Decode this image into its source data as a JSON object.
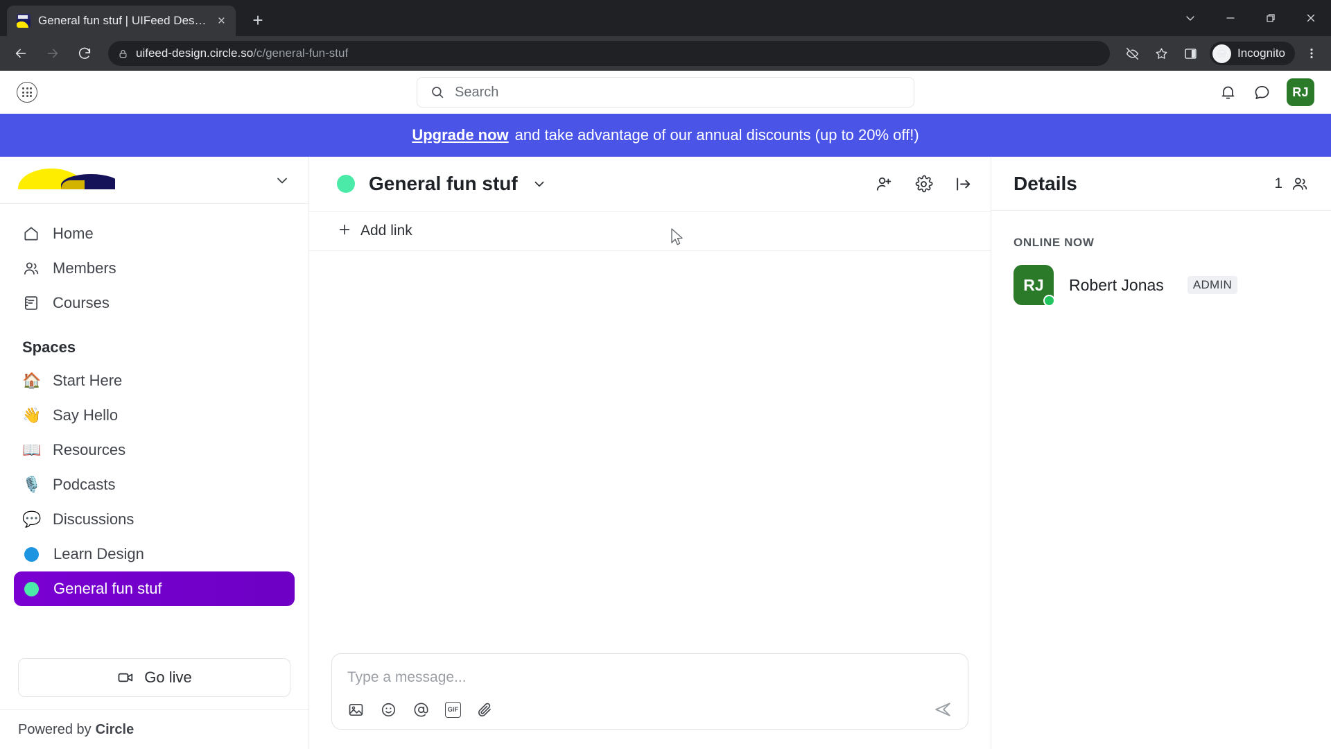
{
  "browser": {
    "tab": {
      "title": "General fun stuf | UIFeed Design",
      "favicon": "uifeed-favicon",
      "close": "×"
    },
    "new_tab_label": "+",
    "window_controls": [
      "chevron-down-icon",
      "minimize-icon",
      "restore-icon",
      "close-icon"
    ],
    "nav": {
      "back": "back-arrow-icon",
      "forward": "forward-arrow-icon",
      "reload": "reload-icon"
    },
    "omnibox": {
      "lock": "lock-icon",
      "domain": "uifeed-design.circle.so",
      "path": "/c/general-fun-stuf"
    },
    "actions": {
      "tracking_protection": "eye-off-icon",
      "bookmark": "star-icon",
      "side_panel": "side-panel-icon",
      "profile_label": "Incognito",
      "menu": "three-dot-menu-icon"
    }
  },
  "app_header": {
    "apps_icon": "apps-grid-icon",
    "search": {
      "placeholder": "Search",
      "value": "",
      "icon": "search-icon"
    },
    "notifications_icon": "bell-icon",
    "messages_icon": "chat-bubble-icon",
    "avatar": {
      "initials": "RJ",
      "color": "#2a7a2a"
    }
  },
  "banner": {
    "link_text": "Upgrade now",
    "text": "and take advantage of our annual discounts (up to 20% off!)",
    "color": "#4a55e8"
  },
  "sidebar": {
    "community_logo": "uifeed-design-logo",
    "community_chevron": "chevron-down-icon",
    "nav": [
      {
        "label": "Home",
        "icon": "home-icon"
      },
      {
        "label": "Members",
        "icon": "members-icon"
      },
      {
        "label": "Courses",
        "icon": "courses-icon"
      }
    ],
    "spaces_heading": "Spaces",
    "spaces": [
      {
        "label": "Start Here",
        "emoji": "🏠",
        "type": "emoji"
      },
      {
        "label": "Say Hello",
        "emoji": "👋",
        "type": "emoji"
      },
      {
        "label": "Resources",
        "emoji": "📖",
        "type": "emoji"
      },
      {
        "label": "Podcasts",
        "emoji": "🎙️",
        "type": "emoji"
      },
      {
        "label": "Discussions",
        "emoji": "💬",
        "type": "emoji"
      },
      {
        "label": "Learn Design",
        "type": "dot",
        "color": "#1e95e0",
        "active": false
      },
      {
        "label": "General fun stuf",
        "type": "dot",
        "color": "#4ceaa8",
        "active": true
      }
    ],
    "go_live": {
      "label": "Go live",
      "icon": "video-camera-icon"
    },
    "powered_by": {
      "prefix": "Powered by",
      "brand": "Circle"
    }
  },
  "channel": {
    "dot_color": "#4ceaa8",
    "title": "General fun stuf",
    "title_chevron": "chevron-down-icon",
    "actions": [
      {
        "name": "invite-member",
        "icon": "person-plus-icon"
      },
      {
        "name": "space-settings",
        "icon": "gear-icon"
      },
      {
        "name": "collapse-panel",
        "icon": "collapse-right-icon"
      }
    ],
    "add_link": {
      "label": "Add link",
      "icon": "plus-icon"
    },
    "composer": {
      "placeholder": "Type a message...",
      "value": "",
      "tools": [
        {
          "name": "image-upload",
          "icon": "image-icon"
        },
        {
          "name": "emoji-picker",
          "icon": "smiley-icon"
        },
        {
          "name": "mention",
          "icon": "at-icon"
        },
        {
          "name": "gif-picker",
          "icon": "gif-icon",
          "text": "GIF"
        },
        {
          "name": "attach-file",
          "icon": "paperclip-icon"
        }
      ],
      "send": {
        "name": "send-message",
        "icon": "send-icon"
      }
    }
  },
  "details": {
    "title": "Details",
    "member_count": "1",
    "members_icon": "members-icon",
    "online_label": "ONLINE NOW",
    "members": [
      {
        "initials": "RJ",
        "name": "Robert Jonas",
        "badge": "ADMIN",
        "avatar_color": "#2a7a2a",
        "status_color": "#22c55e"
      }
    ]
  }
}
